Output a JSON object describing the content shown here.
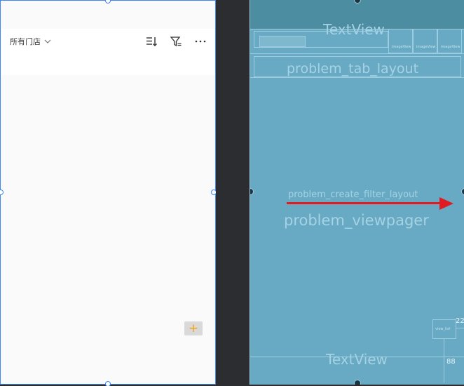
{
  "design_preview": {
    "store_selector_label": "所有门店",
    "fab_symbol": "+"
  },
  "blueprint": {
    "header_textview": "TextView",
    "tab_layout_label": "problem_tab_layout",
    "filter_layout_label": "problem_create_filter_layout",
    "viewpager_label": "problem_viewpager",
    "footer_textview": "TextView",
    "tab_item_label": "imageView",
    "small_box_label": "view_list",
    "margin_right_value": "22",
    "margin_bottom_value": "88"
  },
  "colors": {
    "selection_blue": "#3d86f3",
    "blueprint_bg": "#68aac4",
    "blueprint_header": "#4c8da2",
    "accent_orange": "#f0a21b",
    "arrow_red": "#e11b22"
  }
}
